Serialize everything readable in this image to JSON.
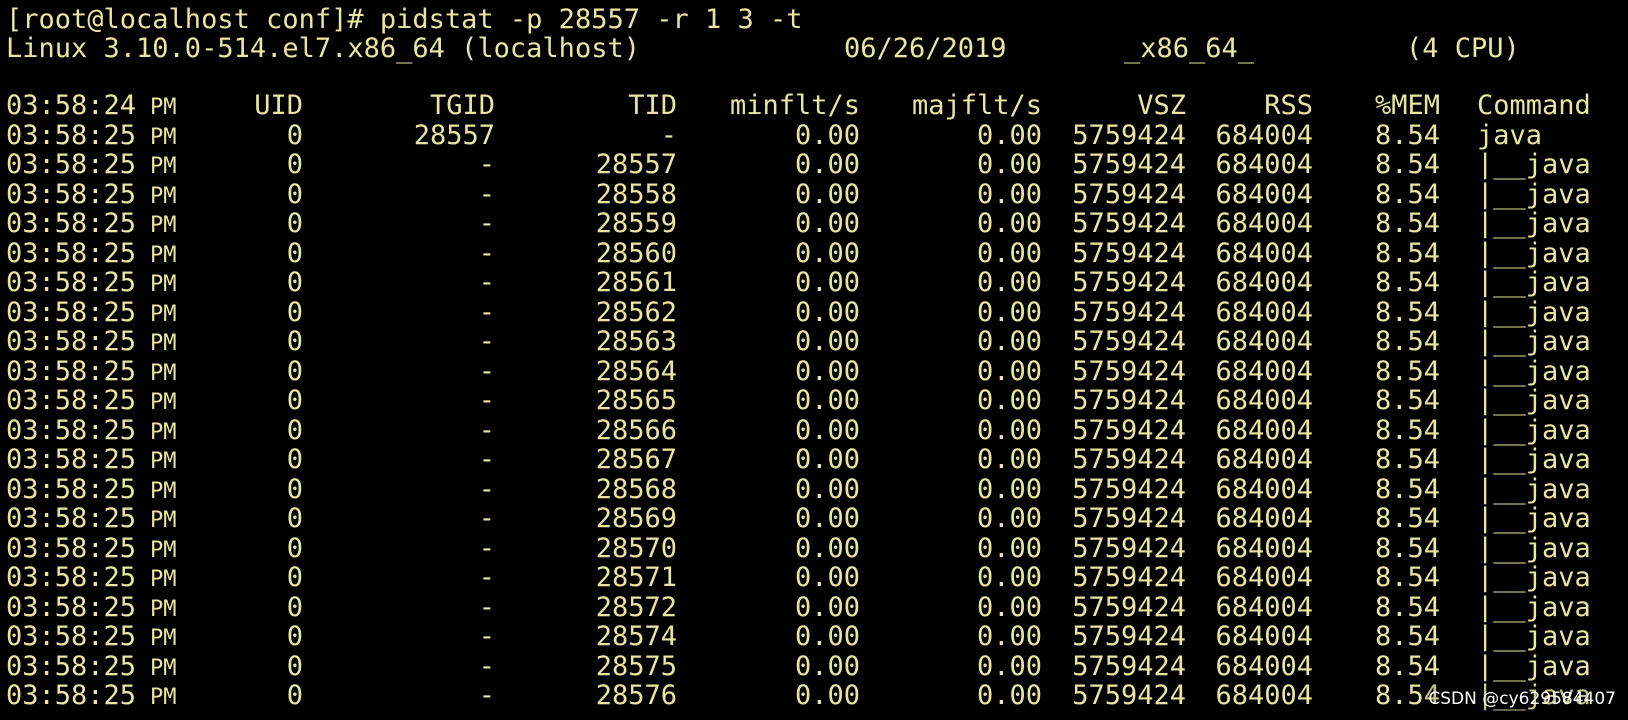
{
  "terminal": {
    "command_line": "[root@localhost conf]# pidstat -p 28557 -r 1 3 -t",
    "info": {
      "kernel": "Linux 3.10.0-514.el7.x86_64 (localhost)",
      "date": "06/26/2019",
      "arch": "_x86_64_",
      "cpus": "(4 CPU)"
    },
    "colors": {
      "background": "#000000",
      "text": "#e8e6a0"
    },
    "columns": [
      "UID",
      "TGID",
      "TID",
      "minflt/s",
      "majflt/s",
      "VSZ",
      "RSS",
      "%MEM",
      "Command"
    ],
    "header_time": "03:58:24",
    "header_ampm": "PM",
    "rows": [
      {
        "time": "03:58:25",
        "ampm": "PM",
        "uid": "0",
        "tgid": "28557",
        "tid": "-",
        "minflt": "0.00",
        "majflt": "0.00",
        "vsz": "5759424",
        "rss": "684004",
        "mem": "8.54",
        "cmd": "java"
      },
      {
        "time": "03:58:25",
        "ampm": "PM",
        "uid": "0",
        "tgid": "-",
        "tid": "28557",
        "minflt": "0.00",
        "majflt": "0.00",
        "vsz": "5759424",
        "rss": "684004",
        "mem": "8.54",
        "cmd": "|__java"
      },
      {
        "time": "03:58:25",
        "ampm": "PM",
        "uid": "0",
        "tgid": "-",
        "tid": "28558",
        "minflt": "0.00",
        "majflt": "0.00",
        "vsz": "5759424",
        "rss": "684004",
        "mem": "8.54",
        "cmd": "|__java"
      },
      {
        "time": "03:58:25",
        "ampm": "PM",
        "uid": "0",
        "tgid": "-",
        "tid": "28559",
        "minflt": "0.00",
        "majflt": "0.00",
        "vsz": "5759424",
        "rss": "684004",
        "mem": "8.54",
        "cmd": "|__java"
      },
      {
        "time": "03:58:25",
        "ampm": "PM",
        "uid": "0",
        "tgid": "-",
        "tid": "28560",
        "minflt": "0.00",
        "majflt": "0.00",
        "vsz": "5759424",
        "rss": "684004",
        "mem": "8.54",
        "cmd": "|__java"
      },
      {
        "time": "03:58:25",
        "ampm": "PM",
        "uid": "0",
        "tgid": "-",
        "tid": "28561",
        "minflt": "0.00",
        "majflt": "0.00",
        "vsz": "5759424",
        "rss": "684004",
        "mem": "8.54",
        "cmd": "|__java"
      },
      {
        "time": "03:58:25",
        "ampm": "PM",
        "uid": "0",
        "tgid": "-",
        "tid": "28562",
        "minflt": "0.00",
        "majflt": "0.00",
        "vsz": "5759424",
        "rss": "684004",
        "mem": "8.54",
        "cmd": "|__java"
      },
      {
        "time": "03:58:25",
        "ampm": "PM",
        "uid": "0",
        "tgid": "-",
        "tid": "28563",
        "minflt": "0.00",
        "majflt": "0.00",
        "vsz": "5759424",
        "rss": "684004",
        "mem": "8.54",
        "cmd": "|__java"
      },
      {
        "time": "03:58:25",
        "ampm": "PM",
        "uid": "0",
        "tgid": "-",
        "tid": "28564",
        "minflt": "0.00",
        "majflt": "0.00",
        "vsz": "5759424",
        "rss": "684004",
        "mem": "8.54",
        "cmd": "|__java"
      },
      {
        "time": "03:58:25",
        "ampm": "PM",
        "uid": "0",
        "tgid": "-",
        "tid": "28565",
        "minflt": "0.00",
        "majflt": "0.00",
        "vsz": "5759424",
        "rss": "684004",
        "mem": "8.54",
        "cmd": "|__java"
      },
      {
        "time": "03:58:25",
        "ampm": "PM",
        "uid": "0",
        "tgid": "-",
        "tid": "28566",
        "minflt": "0.00",
        "majflt": "0.00",
        "vsz": "5759424",
        "rss": "684004",
        "mem": "8.54",
        "cmd": "|__java"
      },
      {
        "time": "03:58:25",
        "ampm": "PM",
        "uid": "0",
        "tgid": "-",
        "tid": "28567",
        "minflt": "0.00",
        "majflt": "0.00",
        "vsz": "5759424",
        "rss": "684004",
        "mem": "8.54",
        "cmd": "|__java"
      },
      {
        "time": "03:58:25",
        "ampm": "PM",
        "uid": "0",
        "tgid": "-",
        "tid": "28568",
        "minflt": "0.00",
        "majflt": "0.00",
        "vsz": "5759424",
        "rss": "684004",
        "mem": "8.54",
        "cmd": "|__java"
      },
      {
        "time": "03:58:25",
        "ampm": "PM",
        "uid": "0",
        "tgid": "-",
        "tid": "28569",
        "minflt": "0.00",
        "majflt": "0.00",
        "vsz": "5759424",
        "rss": "684004",
        "mem": "8.54",
        "cmd": "|__java"
      },
      {
        "time": "03:58:25",
        "ampm": "PM",
        "uid": "0",
        "tgid": "-",
        "tid": "28570",
        "minflt": "0.00",
        "majflt": "0.00",
        "vsz": "5759424",
        "rss": "684004",
        "mem": "8.54",
        "cmd": "|__java"
      },
      {
        "time": "03:58:25",
        "ampm": "PM",
        "uid": "0",
        "tgid": "-",
        "tid": "28571",
        "minflt": "0.00",
        "majflt": "0.00",
        "vsz": "5759424",
        "rss": "684004",
        "mem": "8.54",
        "cmd": "|__java"
      },
      {
        "time": "03:58:25",
        "ampm": "PM",
        "uid": "0",
        "tgid": "-",
        "tid": "28572",
        "minflt": "0.00",
        "majflt": "0.00",
        "vsz": "5759424",
        "rss": "684004",
        "mem": "8.54",
        "cmd": "|__java"
      },
      {
        "time": "03:58:25",
        "ampm": "PM",
        "uid": "0",
        "tgid": "-",
        "tid": "28574",
        "minflt": "0.00",
        "majflt": "0.00",
        "vsz": "5759424",
        "rss": "684004",
        "mem": "8.54",
        "cmd": "|__java"
      },
      {
        "time": "03:58:25",
        "ampm": "PM",
        "uid": "0",
        "tgid": "-",
        "tid": "28575",
        "minflt": "0.00",
        "majflt": "0.00",
        "vsz": "5759424",
        "rss": "684004",
        "mem": "8.54",
        "cmd": "|__java"
      },
      {
        "time": "03:58:25",
        "ampm": "PM",
        "uid": "0",
        "tgid": "-",
        "tid": "28576",
        "minflt": "0.00",
        "majflt": "0.00",
        "vsz": "5759424",
        "rss": "684004",
        "mem": "8.54",
        "cmd": "|__java"
      }
    ]
  },
  "watermark": "CSDN @cy629584407"
}
